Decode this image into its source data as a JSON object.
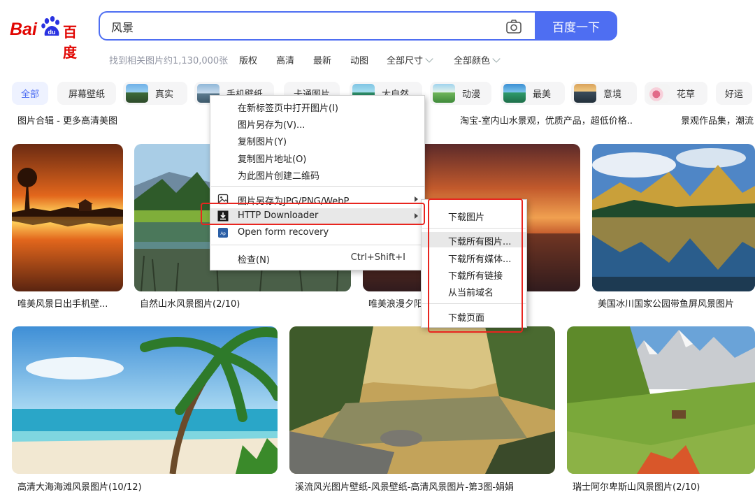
{
  "header": {
    "logo_left": "Bai",
    "logo_mid": "du",
    "logo_right": "百度",
    "search_value": "风景",
    "search_button": "百度一下"
  },
  "filters": {
    "result_count": "找到相关图片约1,130,000张",
    "items": [
      "版权",
      "高清",
      "最新",
      "动图",
      "全部尺寸",
      "全部颜色"
    ]
  },
  "tags": [
    "全部",
    "屏幕壁纸",
    "真实",
    "手机壁纸",
    "卡通图片",
    "大自然",
    "动漫",
    "最美",
    "意境",
    "花草",
    "好运"
  ],
  "top_captions": [
    "图片合辑 - 更多高清美图",
    "淘宝-室内山水景观，优质产品，超低价格..",
    "景观作品集，潮流"
  ],
  "row1_captions": [
    "唯美风景日出手机壁...",
    "自然山水风景图片(2/10)",
    "唯美浪漫夕阳",
    "美国冰川国家公园带鱼屏风景图片"
  ],
  "row2_captions": [
    "高清大海海滩风景图片(10/12)",
    "溪流风光图片壁纸-风景壁纸-高清风景图片-第3图-娟娟",
    "瑞士阿尔卑斯山风景图片(2/10)"
  ],
  "context_menu": {
    "open_new_tab": "在新标签页中打开图片(I)",
    "save_as": "图片另存为(V)...",
    "copy_image": "复制图片(Y)",
    "copy_address": "复制图片地址(O)",
    "create_qr": "为此图片创建二维码",
    "save_as_format": "图片另存为JPG/PNG/WebP",
    "http_downloader": "HTTP Downloader",
    "form_recovery": "Open form recovery",
    "inspect": "检查(N)",
    "inspect_shortcut": "Ctrl+Shift+I"
  },
  "submenu": {
    "download_image": "下载图片",
    "download_all_images": "下载所有图片...",
    "download_all_media": "下载所有媒体...",
    "download_all_links": "下载所有链接",
    "from_current_domain": "从当前域名",
    "download_page": "下载页面"
  },
  "colors": {
    "brand_blue": "#4e6ef2",
    "logo_red": "#e10602",
    "highlight_red": "#e8251f"
  }
}
